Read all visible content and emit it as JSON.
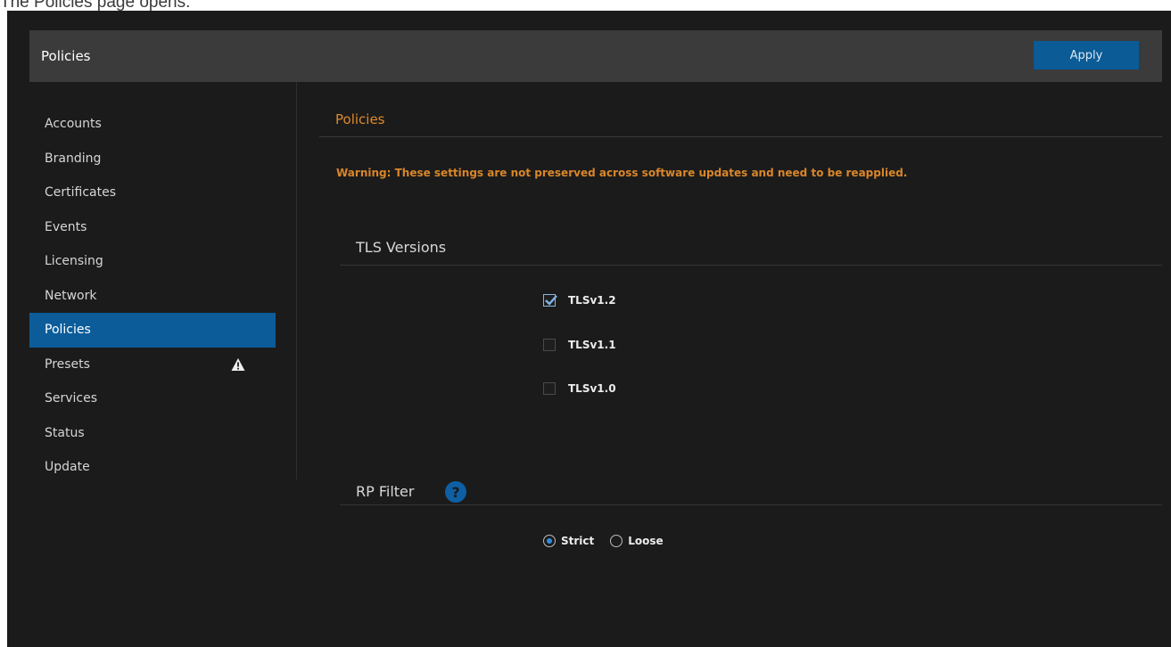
{
  "caption": "The Policies page opens.",
  "header": {
    "title": "Policies",
    "apply_label": "Apply"
  },
  "sidebar": {
    "items": [
      {
        "label": "Accounts"
      },
      {
        "label": "Branding"
      },
      {
        "label": "Certificates"
      },
      {
        "label": "Events"
      },
      {
        "label": "Licensing"
      },
      {
        "label": "Network"
      },
      {
        "label": "Policies",
        "active": true
      },
      {
        "label": "Presets",
        "icon": "warning-triangle-icon"
      },
      {
        "label": "Services"
      },
      {
        "label": "Status"
      },
      {
        "label": "Update"
      }
    ]
  },
  "main": {
    "section_title": "Policies",
    "warning": "Warning: These settings are not preserved across software updates and need to be reapplied.",
    "tls": {
      "title": "TLS Versions",
      "options": [
        {
          "label": "TLSv1.2",
          "checked": true
        },
        {
          "label": "TLSv1.1",
          "checked": false
        },
        {
          "label": "TLSv1.0",
          "checked": false
        }
      ]
    },
    "rp_filter": {
      "title": "RP Filter",
      "help_icon": "question-mark-icon",
      "help_symbol": "?",
      "options": [
        {
          "label": "Strict",
          "selected": true
        },
        {
          "label": "Loose",
          "selected": false
        }
      ]
    }
  },
  "colors": {
    "accent": "#0c5c9a",
    "warning_text": "#d9862a",
    "section_title": "#e0892b",
    "background": "#1b1b1b",
    "titlebar": "#3b3b3b"
  }
}
